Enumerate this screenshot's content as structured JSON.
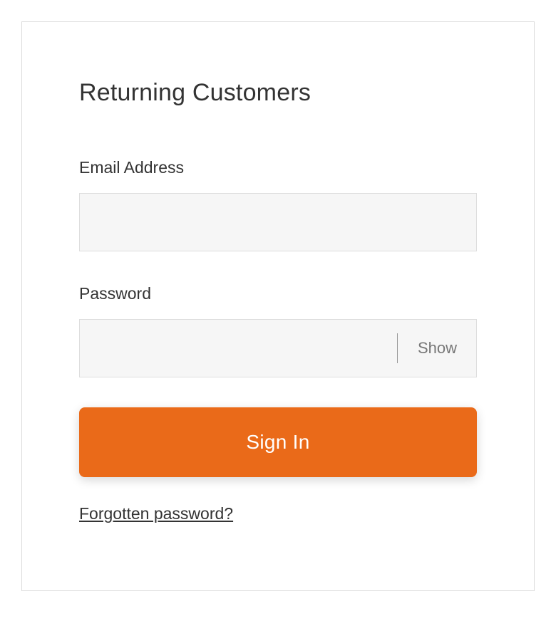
{
  "panel": {
    "heading": "Returning Customers"
  },
  "fields": {
    "email": {
      "label": "Email Address",
      "value": ""
    },
    "password": {
      "label": "Password",
      "value": "",
      "toggle_label": "Show"
    }
  },
  "actions": {
    "signin_label": "Sign In",
    "forgotten_label": "Forgotten password?"
  },
  "colors": {
    "accent": "#EA6A19"
  }
}
